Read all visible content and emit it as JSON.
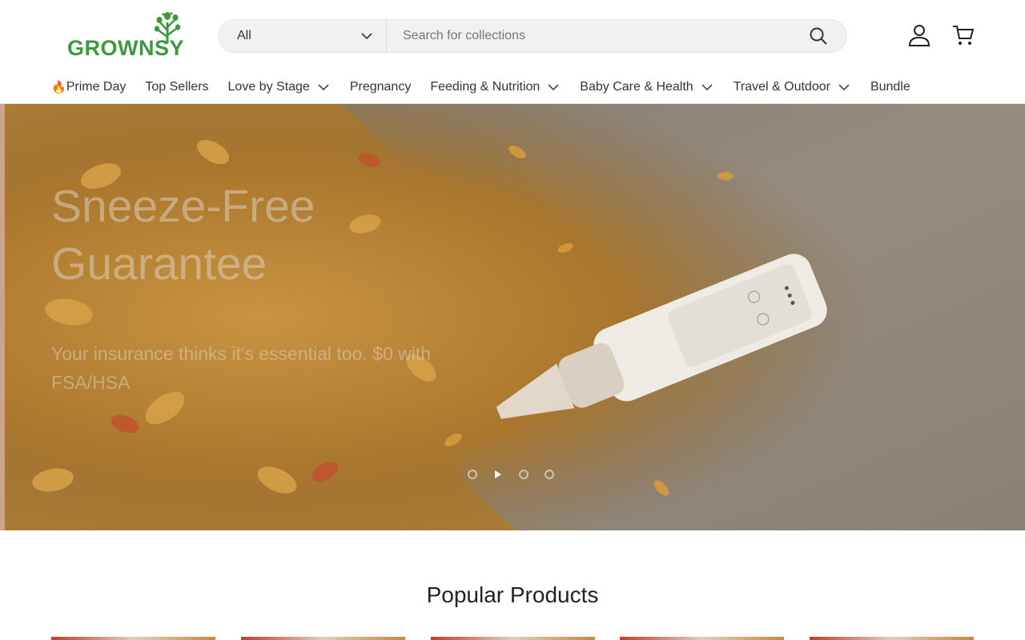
{
  "header": {
    "logo_text": "GROWNSY",
    "search": {
      "category": "All",
      "placeholder": "Search for collections"
    },
    "icons": {
      "account": "account-icon",
      "cart": "cart-icon",
      "search": "search-icon"
    }
  },
  "nav": {
    "items": [
      {
        "label": "Prime Day",
        "prefix": "🔥",
        "has_dropdown": false
      },
      {
        "label": "Top Sellers",
        "has_dropdown": false
      },
      {
        "label": "Love by Stage",
        "has_dropdown": true
      },
      {
        "label": "Pregnancy",
        "has_dropdown": false
      },
      {
        "label": "Feeding & Nutrition",
        "has_dropdown": true
      },
      {
        "label": "Baby Care & Health",
        "has_dropdown": true
      },
      {
        "label": "Travel & Outdoor",
        "has_dropdown": true
      },
      {
        "label": "Bundle",
        "has_dropdown": false
      }
    ]
  },
  "hero": {
    "title": "Sneeze-Free Guarantee",
    "subtitle": "Your insurance thinks it's essential too. $0 with FSA/HSA",
    "slide_count": 3,
    "active_slide": 1
  },
  "popular": {
    "title": "Popular Products",
    "product_count": 5
  },
  "colors": {
    "brand_green": "#3a9a3c",
    "text": "#222222"
  }
}
